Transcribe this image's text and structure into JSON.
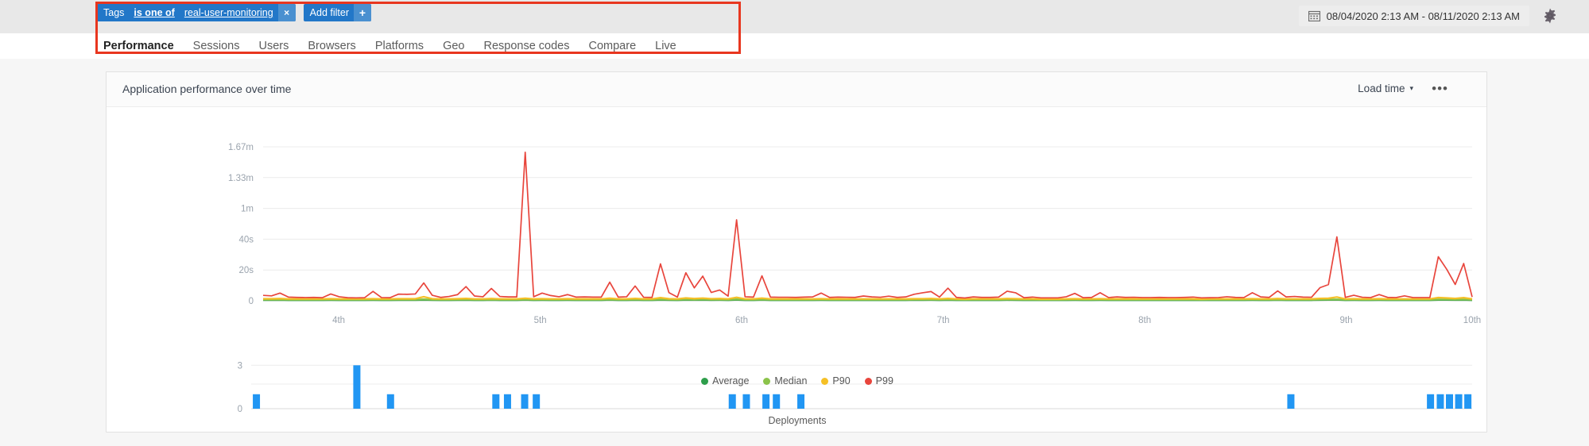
{
  "topbar": {
    "filter_pill": {
      "key": "Tags",
      "operator": "is one of",
      "value": "real-user-monitoring",
      "remove_label": "×"
    },
    "add_filter": {
      "label": "Add filter",
      "plus": "+"
    },
    "date_range": "08/04/2020 2:13 AM - 08/11/2020 2:13 AM",
    "calendar_icon": "calendar-icon",
    "gear_icon": "gear-icon"
  },
  "tabs": [
    {
      "label": "Performance",
      "active": true
    },
    {
      "label": "Sessions",
      "active": false
    },
    {
      "label": "Users",
      "active": false
    },
    {
      "label": "Browsers",
      "active": false
    },
    {
      "label": "Platforms",
      "active": false
    },
    {
      "label": "Geo",
      "active": false
    },
    {
      "label": "Response codes",
      "active": false
    },
    {
      "label": "Compare",
      "active": false
    },
    {
      "label": "Live",
      "active": false
    }
  ],
  "card": {
    "title": "Application performance over time",
    "metric_selector": "Load time",
    "metric_caret": "▾",
    "more_menu": "•••"
  },
  "colors": {
    "accent_blue": "#2277c8",
    "highlight_red": "#e8361f",
    "average": "#2e9e4b",
    "median": "#8bc34a",
    "p90": "#f5c026",
    "p99": "#e8453c",
    "deployment_bar": "#2196f3"
  },
  "chart_data": [
    {
      "type": "line",
      "title": "Application performance over time",
      "xlabel": "",
      "ylabel": "",
      "grid": true,
      "legend_position": "bottom-center",
      "ytick_labels": [
        "1.67m",
        "1.33m",
        "1m",
        "40s",
        "20s",
        "0"
      ],
      "ytick_values": [
        100,
        80,
        60,
        40,
        20,
        0
      ],
      "ylim": [
        0,
        100
      ],
      "xtick_labels": [
        "4th",
        "5th",
        "6th",
        "7th",
        "8th",
        "9th",
        "10th"
      ],
      "xtick_positions": [
        0.0625,
        0.2292,
        0.3958,
        0.5625,
        0.7292,
        0.8958,
        1.0
      ],
      "series": [
        {
          "name": "P99",
          "color": "#e8453c",
          "values": [
            3.5,
            3.2,
            5.0,
            2.4,
            2.2,
            2.1,
            2.2,
            2.0,
            4.4,
            2.6,
            2.0,
            1.9,
            2.0,
            6.1,
            2.1,
            2.0,
            4.3,
            4.2,
            4.4,
            11.6,
            3.6,
            2.2,
            2.8,
            4.0,
            9.2,
            3.1,
            2.6,
            8.0,
            2.8,
            2.5,
            2.5,
            96.5,
            2.6,
            5.0,
            3.4,
            2.6,
            4.0,
            2.4,
            2.5,
            2.4,
            2.4,
            12.1,
            2.4,
            2.6,
            9.6,
            2.3,
            2.2,
            24.0,
            5.3,
            2.4,
            18.2,
            8.4,
            16.0,
            5.4,
            7.0,
            3.0,
            52.6,
            2.6,
            2.4,
            16.2,
            2.4,
            2.3,
            2.3,
            2.2,
            2.4,
            2.5,
            5.0,
            2.2,
            2.4,
            2.3,
            2.2,
            3.1,
            2.5,
            2.3,
            3.0,
            2.2,
            2.5,
            4.2,
            5.2,
            6.0,
            2.4,
            8.2,
            2.2,
            1.8,
            2.5,
            2.2,
            2.2,
            2.4,
            6.2,
            5.2,
            2.0,
            2.4,
            1.9,
            1.9,
            1.9,
            2.6,
            4.8,
            2.0,
            2.2,
            5.2,
            2.1,
            2.5,
            2.2,
            2.3,
            2.1,
            2.1,
            2.2,
            2.1,
            2.1,
            2.2,
            2.4,
            1.9,
            2.0,
            2.1,
            2.6,
            2.2,
            2.1,
            5.2,
            2.5,
            2.2,
            6.4,
            2.5,
            2.8,
            2.4,
            2.3,
            8.5,
            10.5,
            41.5,
            2.2,
            3.6,
            2.3,
            2.1,
            4.0,
            2.2,
            2.1,
            3.2,
            2.1,
            2.1,
            2.1,
            28.6,
            20.4,
            10.6,
            24.2,
            2.5
          ]
        },
        {
          "name": "P90",
          "color": "#f5c026",
          "values": [
            1.3,
            1.3,
            1.4,
            1.2,
            1.2,
            1.2,
            1.2,
            1.2,
            1.3,
            1.2,
            1.2,
            1.2,
            1.2,
            1.3,
            1.2,
            1.2,
            1.3,
            1.3,
            1.3,
            2.6,
            1.3,
            1.2,
            1.2,
            1.3,
            1.5,
            1.2,
            1.2,
            1.4,
            1.2,
            1.2,
            1.2,
            1.6,
            1.2,
            1.3,
            1.2,
            1.2,
            1.3,
            1.2,
            1.2,
            1.2,
            1.2,
            1.6,
            1.2,
            1.2,
            1.5,
            1.2,
            1.2,
            2.0,
            1.3,
            1.2,
            1.8,
            1.4,
            1.7,
            1.3,
            1.4,
            1.2,
            2.2,
            1.2,
            1.2,
            1.7,
            1.2,
            1.2,
            1.2,
            1.2,
            1.2,
            1.2,
            1.3,
            1.2,
            1.2,
            1.2,
            1.2,
            1.2,
            1.2,
            1.2,
            1.2,
            1.2,
            1.2,
            1.3,
            1.3,
            1.4,
            1.2,
            1.5,
            1.2,
            1.1,
            1.2,
            1.2,
            1.2,
            1.2,
            1.4,
            1.3,
            1.2,
            1.2,
            1.1,
            1.1,
            1.1,
            1.2,
            1.3,
            1.2,
            1.2,
            1.3,
            1.2,
            1.2,
            1.2,
            1.2,
            1.2,
            1.2,
            1.2,
            1.2,
            1.2,
            1.2,
            1.2,
            1.1,
            1.2,
            1.2,
            1.2,
            1.2,
            1.2,
            1.3,
            1.2,
            1.2,
            1.4,
            1.2,
            1.2,
            1.2,
            1.2,
            1.5,
            1.6,
            2.4,
            1.2,
            1.3,
            1.2,
            1.2,
            1.3,
            1.2,
            1.2,
            1.2,
            1.2,
            1.2,
            1.2,
            2.1,
            1.8,
            1.5,
            2.0,
            1.2
          ]
        },
        {
          "name": "Median",
          "color": "#8bc34a",
          "values": [
            0.75,
            0.75,
            0.8,
            0.7,
            0.7,
            0.7,
            0.7,
            0.7,
            0.75,
            0.7,
            0.7,
            0.7,
            0.7,
            0.75,
            0.7,
            0.7,
            0.75,
            0.75,
            0.75,
            0.95,
            0.75,
            0.7,
            0.7,
            0.75,
            0.8,
            0.7,
            0.7,
            0.78,
            0.7,
            0.7,
            0.7,
            0.85,
            0.7,
            0.75,
            0.7,
            0.7,
            0.75,
            0.7,
            0.7,
            0.7,
            0.7,
            0.85,
            0.7,
            0.7,
            0.8,
            0.7,
            0.7,
            0.9,
            0.75,
            0.7,
            0.88,
            0.78,
            0.86,
            0.75,
            0.78,
            0.7,
            0.95,
            0.7,
            0.7,
            0.85,
            0.7,
            0.7,
            0.7,
            0.7,
            0.7,
            0.7,
            0.75,
            0.7,
            0.7,
            0.7,
            0.7,
            0.7,
            0.7,
            0.7,
            0.7,
            0.7,
            0.7,
            0.75,
            0.75,
            0.78,
            0.7,
            0.8,
            0.7,
            0.66,
            0.7,
            0.7,
            0.7,
            0.7,
            0.78,
            0.75,
            0.7,
            0.7,
            0.66,
            0.66,
            0.66,
            0.7,
            0.75,
            0.7,
            0.7,
            0.75,
            0.7,
            0.7,
            0.7,
            0.7,
            0.7,
            0.7,
            0.7,
            0.7,
            0.7,
            0.7,
            0.7,
            0.66,
            0.7,
            0.7,
            0.7,
            0.7,
            0.7,
            0.75,
            0.7,
            0.7,
            0.78,
            0.7,
            0.7,
            0.7,
            0.7,
            0.8,
            0.85,
            0.92,
            0.7,
            0.75,
            0.7,
            0.7,
            0.75,
            0.7,
            0.7,
            0.7,
            0.7,
            0.7,
            0.7,
            0.9,
            0.88,
            0.8,
            0.9,
            0.7
          ]
        },
        {
          "name": "Average",
          "color": "#2e9e4b",
          "values": [
            0.45,
            0.45,
            0.5,
            0.4,
            0.4,
            0.4,
            0.4,
            0.4,
            0.45,
            0.4,
            0.4,
            0.4,
            0.4,
            0.45,
            0.4,
            0.4,
            0.45,
            0.45,
            0.45,
            0.6,
            0.45,
            0.4,
            0.4,
            0.45,
            0.5,
            0.4,
            0.4,
            0.48,
            0.4,
            0.4,
            0.4,
            0.55,
            0.4,
            0.45,
            0.4,
            0.4,
            0.45,
            0.4,
            0.4,
            0.4,
            0.4,
            0.55,
            0.4,
            0.4,
            0.5,
            0.4,
            0.4,
            0.6,
            0.45,
            0.4,
            0.58,
            0.48,
            0.56,
            0.45,
            0.48,
            0.4,
            0.65,
            0.4,
            0.4,
            0.55,
            0.4,
            0.4,
            0.4,
            0.4,
            0.4,
            0.4,
            0.45,
            0.4,
            0.4,
            0.4,
            0.4,
            0.4,
            0.4,
            0.4,
            0.4,
            0.4,
            0.4,
            0.45,
            0.45,
            0.48,
            0.4,
            0.5,
            0.4,
            0.36,
            0.4,
            0.4,
            0.4,
            0.4,
            0.48,
            0.45,
            0.4,
            0.4,
            0.36,
            0.36,
            0.36,
            0.4,
            0.45,
            0.4,
            0.4,
            0.45,
            0.4,
            0.4,
            0.4,
            0.4,
            0.4,
            0.4,
            0.4,
            0.4,
            0.4,
            0.4,
            0.4,
            0.36,
            0.4,
            0.4,
            0.4,
            0.4,
            0.4,
            0.45,
            0.4,
            0.4,
            0.48,
            0.4,
            0.4,
            0.4,
            0.4,
            0.5,
            0.55,
            0.62,
            0.4,
            0.45,
            0.4,
            0.4,
            0.45,
            0.4,
            0.4,
            0.4,
            0.4,
            0.4,
            0.4,
            0.6,
            0.58,
            0.5,
            0.6,
            0.4
          ]
        }
      ],
      "legend": [
        {
          "name": "Average",
          "color": "#2e9e4b"
        },
        {
          "name": "Median",
          "color": "#8bc34a"
        },
        {
          "name": "P90",
          "color": "#f5c026"
        },
        {
          "name": "P99",
          "color": "#e8453c"
        }
      ]
    },
    {
      "type": "bar",
      "title": "Deployments",
      "xlabel": "Deployments",
      "ylabel": "",
      "ytick_labels": [
        "3",
        "0"
      ],
      "ytick_values": [
        3,
        0
      ],
      "ylim": [
        0,
        3.4
      ],
      "bar_color": "#2196f3",
      "bars": [
        {
          "x": 0.0075,
          "value": 1
        },
        {
          "x": 0.0895,
          "value": 3
        },
        {
          "x": 0.117,
          "value": 1
        },
        {
          "x": 0.203,
          "value": 1
        },
        {
          "x": 0.2125,
          "value": 1
        },
        {
          "x": 0.2265,
          "value": 1
        },
        {
          "x": 0.236,
          "value": 1
        },
        {
          "x": 0.396,
          "value": 1
        },
        {
          "x": 0.4075,
          "value": 1
        },
        {
          "x": 0.4235,
          "value": 1
        },
        {
          "x": 0.432,
          "value": 1
        },
        {
          "x": 0.452,
          "value": 1
        },
        {
          "x": 0.852,
          "value": 1
        },
        {
          "x": 0.966,
          "value": 1
        },
        {
          "x": 0.974,
          "value": 1
        },
        {
          "x": 0.9815,
          "value": 1
        },
        {
          "x": 0.989,
          "value": 1
        },
        {
          "x": 0.9965,
          "value": 1
        }
      ]
    }
  ]
}
